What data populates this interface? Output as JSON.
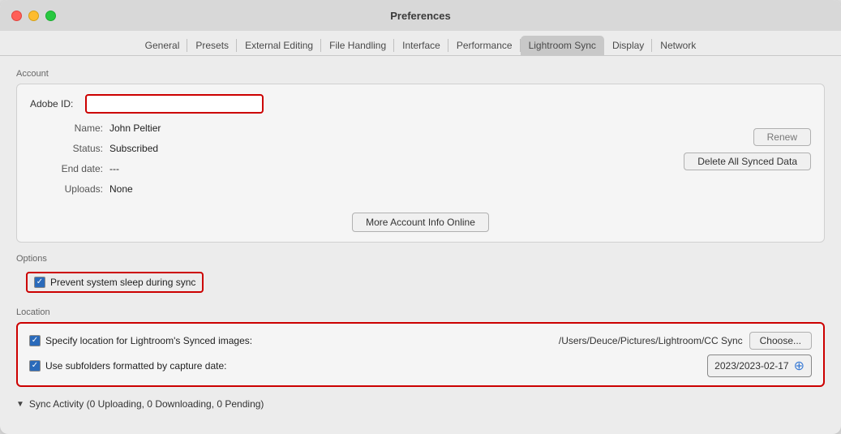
{
  "window": {
    "title": "Preferences"
  },
  "tabs": [
    {
      "id": "general",
      "label": "General",
      "active": false
    },
    {
      "id": "presets",
      "label": "Presets",
      "active": false
    },
    {
      "id": "external-editing",
      "label": "External Editing",
      "active": false
    },
    {
      "id": "file-handling",
      "label": "File Handling",
      "active": false
    },
    {
      "id": "interface",
      "label": "Interface",
      "active": false
    },
    {
      "id": "performance",
      "label": "Performance",
      "active": false
    },
    {
      "id": "lightroom-sync",
      "label": "Lightroom Sync",
      "active": true
    },
    {
      "id": "display",
      "label": "Display",
      "active": false
    },
    {
      "id": "network",
      "label": "Network",
      "active": false
    }
  ],
  "account": {
    "section_label": "Account",
    "adobe_id_label": "Adobe ID:",
    "adobe_id_value": "",
    "name_key": "Name:",
    "name_val": "John Peltier",
    "status_key": "Status:",
    "status_val": "Subscribed",
    "end_date_key": "End date:",
    "end_date_val": "---",
    "uploads_key": "Uploads:",
    "uploads_val": "None",
    "renew_label": "Renew",
    "delete_label": "Delete All Synced Data",
    "more_info_label": "More Account Info Online"
  },
  "options": {
    "section_label": "Options",
    "prevent_sleep_label": "Prevent system sleep during sync",
    "prevent_sleep_checked": true
  },
  "location": {
    "section_label": "Location",
    "specify_label": "Specify location for Lightroom's Synced images:",
    "specify_checked": true,
    "path_val": "/Users/Deuce/Pictures/Lightroom/CC Sync",
    "choose_label": "Choose...",
    "subfolders_label": "Use subfolders formatted by capture date:",
    "subfolders_checked": true,
    "date_val": "2023/2023-02-17"
  },
  "sync_activity": {
    "label": "Sync Activity  (0 Uploading, 0 Downloading, 0 Pending)"
  }
}
